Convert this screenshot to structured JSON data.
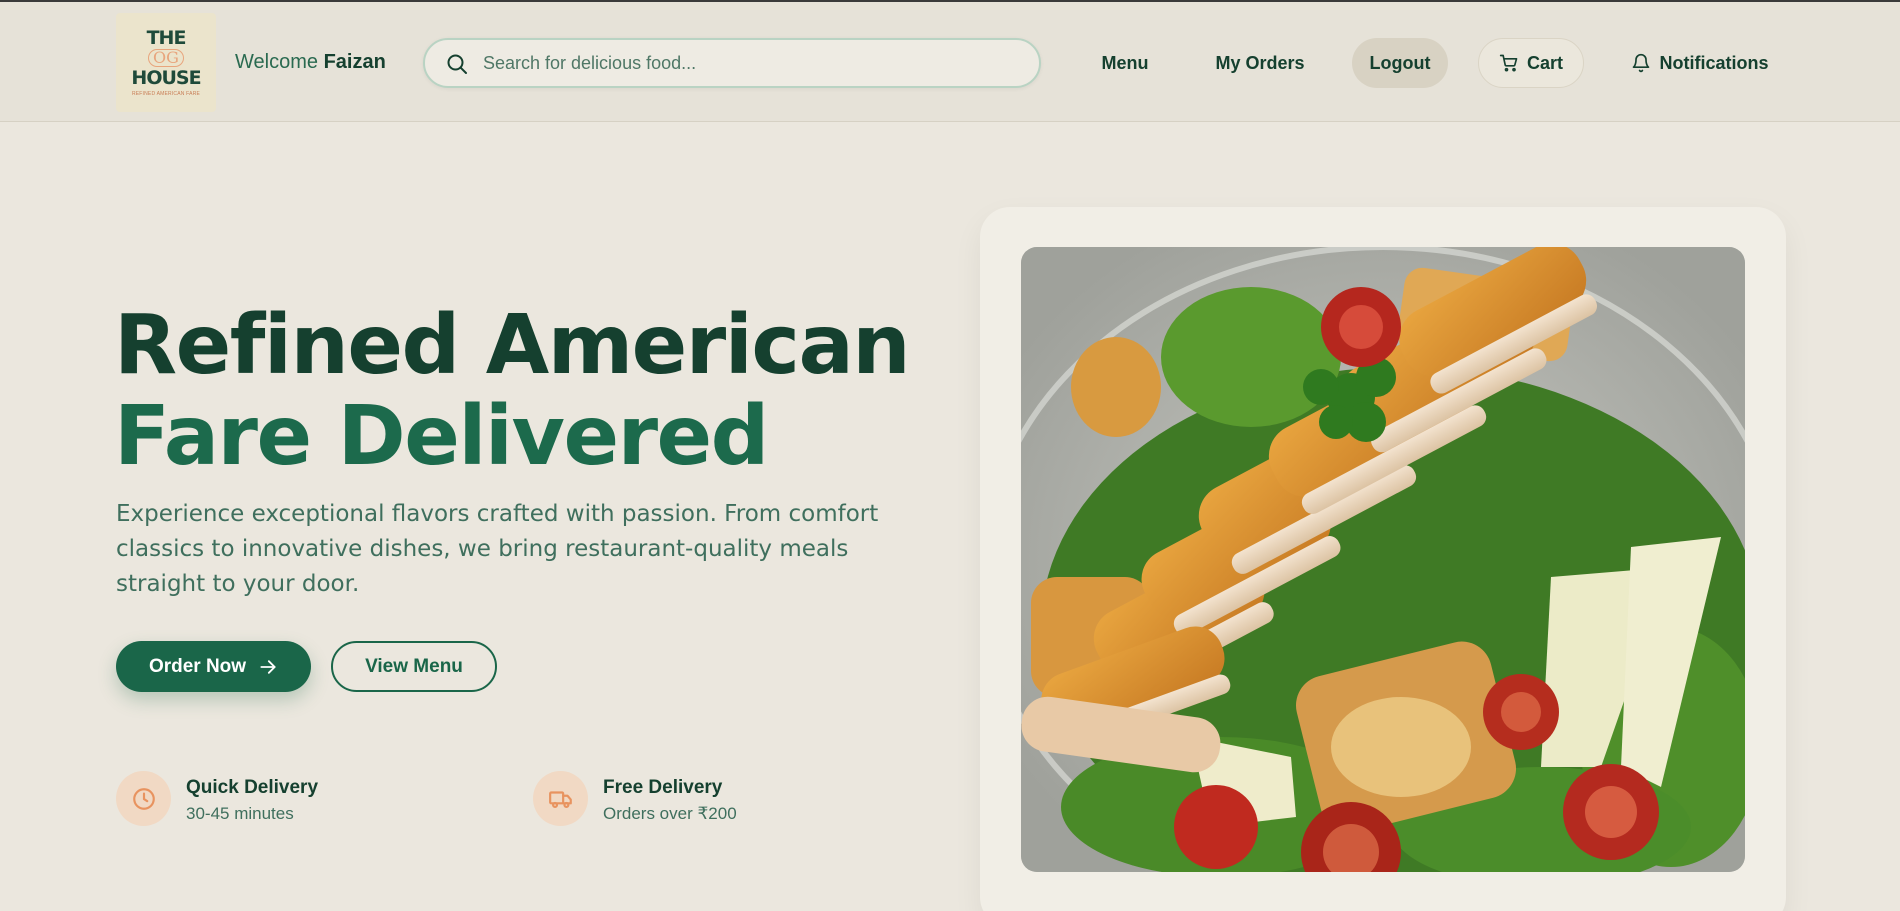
{
  "header": {
    "logo": {
      "line1": "THE",
      "line2": "OG",
      "line3": "HOUSE",
      "tagline": "REFINED AMERICAN FARE"
    },
    "welcome_prefix": "Welcome",
    "user_name": "Faizan",
    "search": {
      "placeholder": "Search for delicious food...",
      "value": ""
    },
    "nav": {
      "menu": "Menu",
      "orders": "My Orders",
      "logout": "Logout",
      "cart": "Cart",
      "notifications": "Notifications"
    }
  },
  "hero": {
    "title_line1": "Refined American",
    "title_line2": "Fare Delivered",
    "description": "Experience exceptional flavors crafted with passion. From comfort classics to innovative dishes, we bring restaurant-quality meals straight to your door.",
    "order_button": "Order Now",
    "view_menu_button": "View Menu"
  },
  "features": [
    {
      "title": "Quick Delivery",
      "subtitle": "30-45 minutes",
      "icon": "clock-icon"
    },
    {
      "title": "Free Delivery",
      "subtitle": "Orders over ₹200",
      "icon": "truck-icon"
    }
  ],
  "colors": {
    "primary": "#1a6649",
    "dark_green": "#15402f",
    "accent_orange": "#e8935f",
    "background": "#ebe7de"
  }
}
